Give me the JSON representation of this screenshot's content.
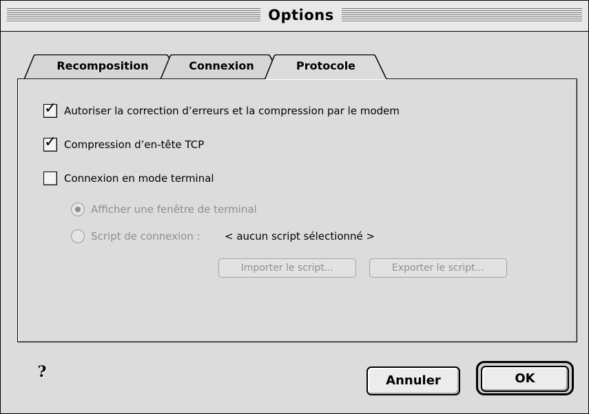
{
  "window": {
    "title": "Options"
  },
  "tabs": [
    {
      "label": "Recomposition",
      "selected": false
    },
    {
      "label": "Connexion",
      "selected": false
    },
    {
      "label": "Protocole",
      "selected": true
    }
  ],
  "options": {
    "error_correction": {
      "label": "Autoriser la correction d’erreurs et la compression par le modem",
      "checked": true
    },
    "tcp_header": {
      "label": "Compression d’en-tête TCP",
      "checked": true
    },
    "terminal_mode": {
      "label": "Connexion en mode terminal",
      "checked": false
    },
    "terminal_window": {
      "label": "Afficher une fenêtre de terminal",
      "selected": true,
      "enabled": false
    },
    "connect_script": {
      "label": "Script de connexion :",
      "value": "< aucun script sélectionné >",
      "selected": false,
      "enabled": false
    }
  },
  "script_buttons": {
    "import_label": "Importer le script...",
    "export_label": "Exporter le script..."
  },
  "footer": {
    "help_icon": "question-mark-icon",
    "help_glyph": "?",
    "cancel_label": "Annuler",
    "ok_label": "OK"
  },
  "colors": {
    "window_bg": "#dcdcdc",
    "disabled_text": "#8e8e8e"
  }
}
